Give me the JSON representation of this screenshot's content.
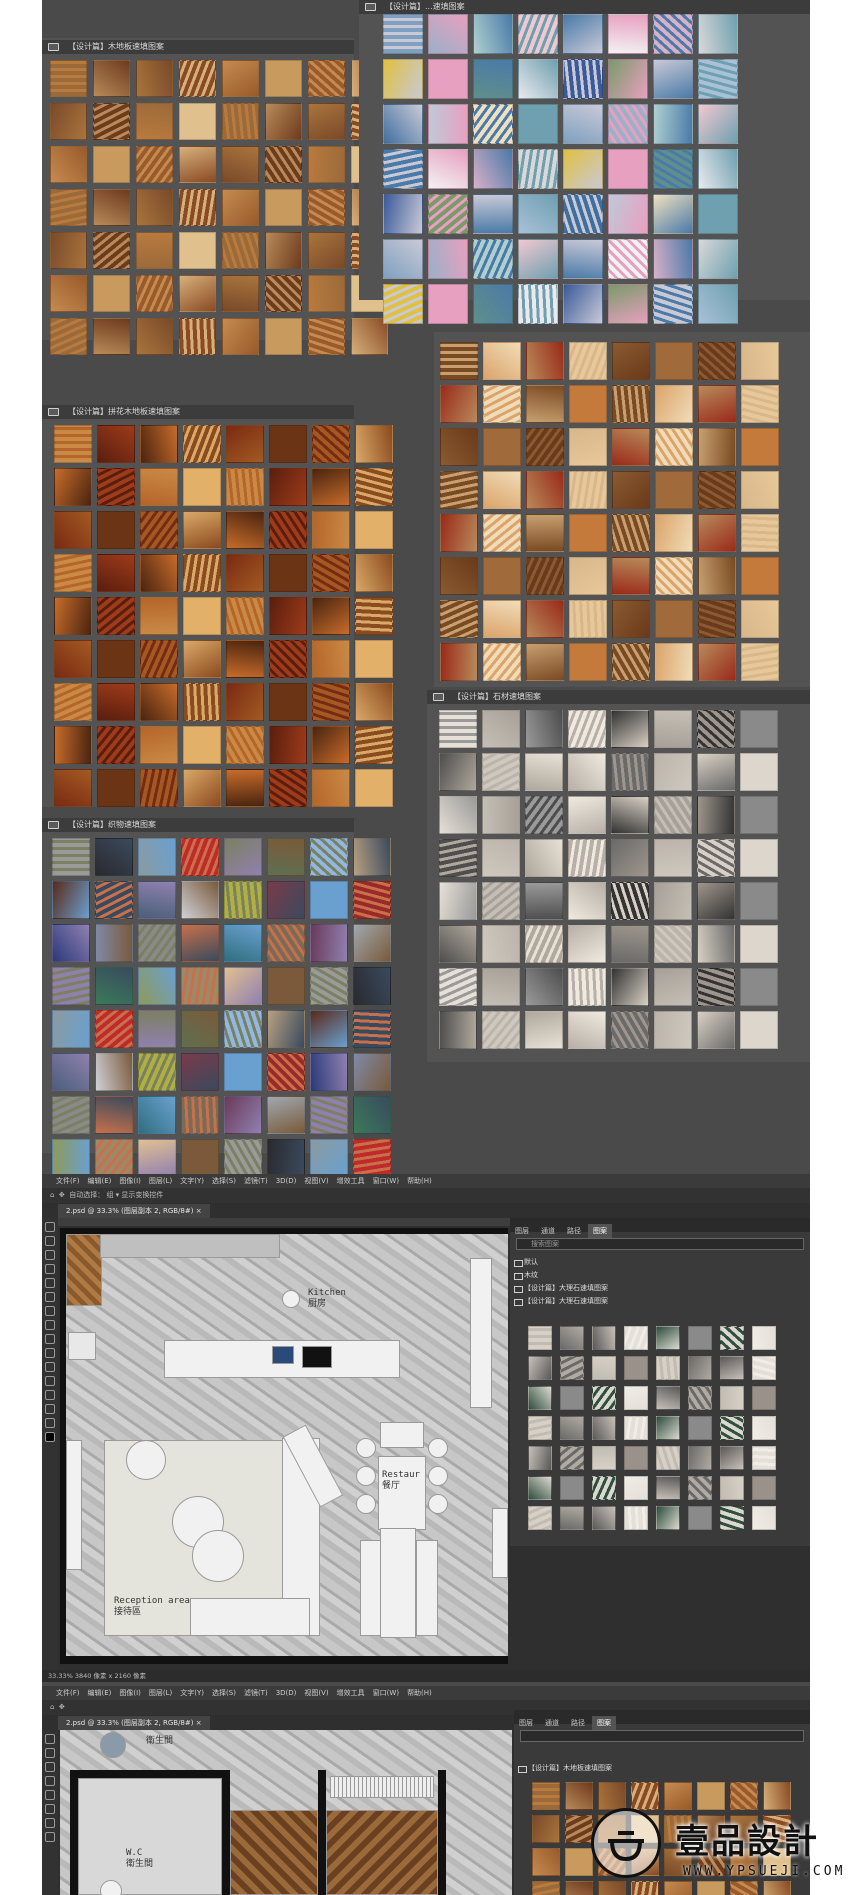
{
  "panels": {
    "wood_floor": {
      "title": "【设计篇】木地板速填图案"
    },
    "pattern_top_right": {
      "title": "【设计篇】...速填图案"
    },
    "parquet": {
      "title": "【设计篇】拼花木地板速填图案"
    },
    "fabric": {
      "title": "【设计篇】织物速填图案"
    },
    "stone": {
      "title": "【设计篇】石材速填图案"
    }
  },
  "ps1": {
    "menu": [
      "文件(F)",
      "编辑(E)",
      "图像(I)",
      "图层(L)",
      "文字(Y)",
      "选择(S)",
      "滤镜(T)",
      "3D(D)",
      "视图(V)",
      "增效工具",
      "窗口(W)",
      "帮助(H)"
    ],
    "options": "自动选择：  组  ▾   显示变换控件",
    "doc_tab": "2.psd @ 33.3% (图层副本 2, RGB/8#) ×",
    "panel_tabs": [
      "图层",
      "通道",
      "路径",
      "图案"
    ],
    "panel_search": "搜索图案",
    "panel_rows": [
      "默认",
      "木纹",
      "【设计篇】大理石速填图案",
      "【设计篇】大理石速填图案"
    ],
    "status": "33.33%   3840 像素 x 2160 像素",
    "labels": {
      "kitchen": "Kitchen\n厨房",
      "restaurant": "Restaur\n餐厅",
      "reception": "Reception area\n接待區"
    }
  },
  "ps2": {
    "menu": [
      "文件(F)",
      "编辑(E)",
      "图像(I)",
      "图层(L)",
      "文字(Y)",
      "选择(S)",
      "滤镜(T)",
      "3D(D)",
      "视图(V)",
      "增效工具",
      "窗口(W)",
      "帮助(H)"
    ],
    "doc_tab": "2.psd @ 33.3% (图层副本 2, RGB/8#) ×",
    "panel_tabs": [
      "图层",
      "通道",
      "路径",
      "图案"
    ],
    "panel_rows": [
      "【设计篇】木地板速填图案"
    ],
    "labels": {
      "wc_top": "衛生間",
      "wc": "W.C\n衛生間"
    }
  },
  "watermark": {
    "brand": "壹品設計",
    "url": "WWW.YPSUEJI.COM"
  },
  "colors": {
    "wood": [
      "#8a4a24",
      "#b97a3e",
      "#c89a5e",
      "#9b6a3a",
      "#d6b07a",
      "#a9743c",
      "#6e3b1d",
      "#c48b4f",
      "#e0c08c",
      "#9a5a2c",
      "#b78a5a",
      "#7a4a2a"
    ],
    "parquet": [
      "#8c4a1f",
      "#b5652a",
      "#6b3414",
      "#c98a46",
      "#d9a968",
      "#4a2410",
      "#9e3b1a",
      "#7a2a12",
      "#e3b06a",
      "#a35a22",
      "#5a1e0e",
      "#c76c2a"
    ],
    "fabric": [
      "#7a6a58",
      "#7b8060",
      "#7f8aa8",
      "#9a9a9a",
      "#7a3a4a",
      "#8f9a5a",
      "#3a4a5e",
      "#6a3a5a",
      "#5f6f50",
      "#8a8a8a",
      "#2a2a2e",
      "#6aa0d0",
      "#9a8a6a",
      "#4a5f7a",
      "#a0a8b0",
      "#90b8e0",
      "#c8704a",
      "#8a9aa0",
      "#9a2a2a",
      "#e0c090",
      "#d0d0d8",
      "#9080b0",
      "#b8a080",
      "#2f6f7f",
      "#c02a2a",
      "#2a3a7a",
      "#7a5a3a",
      "#b0b040",
      "#3a7a5a",
      "#5a2a1a"
    ],
    "stone": [
      "#b8b0a8",
      "#9a9a9a",
      "#cfc8be",
      "#e6e0d6",
      "#8a8a8a",
      "#d8d0c4",
      "#a8a098",
      "#6a6a6a",
      "#efe9df",
      "#b0a89c",
      "#c4bfb6",
      "#4e4e4e",
      "#dcd6cc",
      "#9e968c",
      "#bcb4aa",
      "#333333"
    ],
    "tiles_top_right": [
      "#e9e9ee",
      "#c9c9d6",
      "#bfc9d8",
      "#7fa0c0",
      "#f0c8d0",
      "#d8b0c8",
      "#e8a0c0",
      "#3a5a9a",
      "#a8c0d8",
      "#f0e0c0",
      "#9ab0c8",
      "#4a7aa8",
      "#d8d8d8",
      "#5f8f8a",
      "#7a9a6a",
      "#3f6f9f",
      "#6fa0b0",
      "#b0d0d0",
      "#f2f2f2",
      "#e0c040"
    ],
    "veneer": [
      "#e8c89a",
      "#c8a070",
      "#a06a3a",
      "#7a4a22",
      "#d8b88a",
      "#b88a5a",
      "#f0dcb8",
      "#8a5a32",
      "#c47a3a",
      "#6a3a1a",
      "#dca46a",
      "#9a2a1a"
    ],
    "marble_small": [
      "#e4dfd8",
      "#c0bcb4",
      "#8a8a8a",
      "#d8d0c4",
      "#f0ece6",
      "#5a5a5a",
      "#b0aaa0",
      "#2f4f3f",
      "#9a928a",
      "#dcd8d0",
      "#6a6a6a",
      "#c8c0b8"
    ]
  }
}
